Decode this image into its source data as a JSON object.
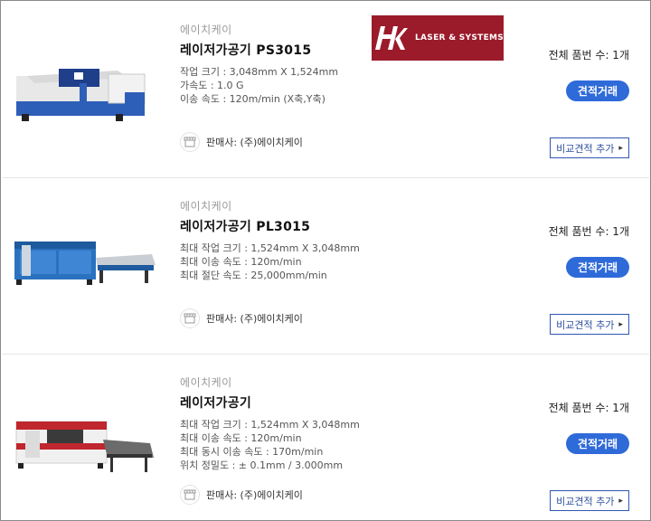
{
  "products": [
    {
      "brand": "에이치케이",
      "title": "레이저가공기 PS3015",
      "specs": [
        "작업 크기 : 3,048mm X 1,524mm",
        "가속도 : 1.0 G",
        "이송 속도 : 120m/min (X축,Y축)"
      ],
      "seller": "판매사: (주)에이치케이",
      "count": "전체 품번 수: 1개",
      "deal_label": "견적거래",
      "compare_label": "비교견적 추가",
      "image": "laser-cutting-machine-blue-white",
      "logo": {
        "mark": "HK",
        "text": "LASER & SYSTEMS",
        "color": "#9b1b2a"
      }
    },
    {
      "brand": "에이치케이",
      "title": "레이저가공기 PL3015",
      "specs": [
        "최대 작업 크기 : 1,524mm X 3,048mm",
        "최대 이송 속도 : 120m/min",
        "최대 절단 속도 : 25,000mm/min"
      ],
      "seller": "판매사: (주)에이치케이",
      "count": "전체 품번 수: 1개",
      "deal_label": "견적거래",
      "compare_label": "비교견적 추가",
      "image": "laser-cutting-machine-blue"
    },
    {
      "brand": "에이치케이",
      "title": "레이저가공기",
      "specs": [
        "최대 작업 크기 : 1,524mm X 3,048mm",
        "최대 이송 속도 : 120m/min",
        "최대 동시 이송 속도 : 170m/min",
        "위치 정밀도 : ± 0.1mm / 3.000mm"
      ],
      "seller": "판매사: (주)에이치케이",
      "count": "전체 품번 수: 1개",
      "deal_label": "견적거래",
      "compare_label": "비교견적 추가",
      "image": "laser-cutting-machine-red-white"
    }
  ],
  "colors": {
    "accent": "#2f6ad9",
    "compare_border": "#2f56b0",
    "brand_text": "#9a9a9a"
  },
  "icons": {
    "store": "store-icon",
    "chevron": "chevron-right-icon"
  }
}
